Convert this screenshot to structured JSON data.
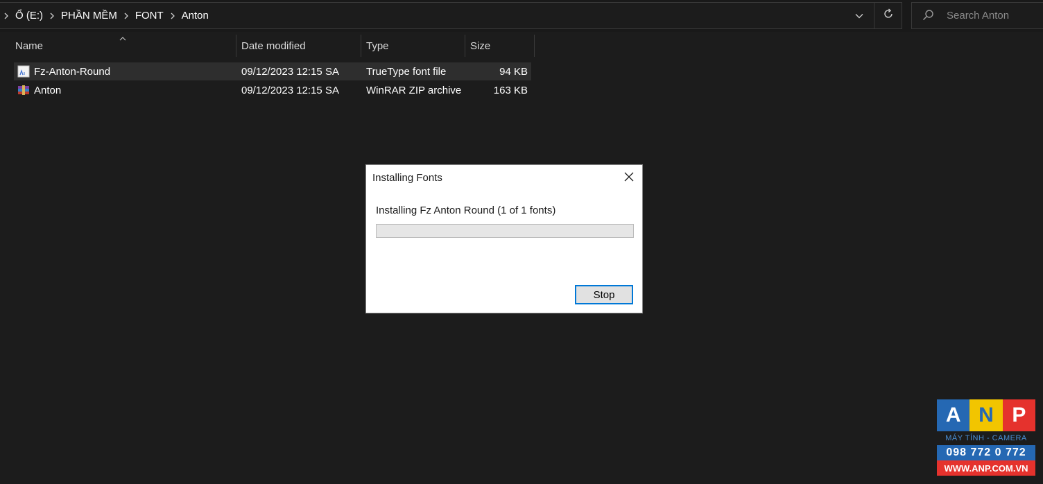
{
  "breadcrumb": {
    "items": [
      "Ổ (E:)",
      "PHẦN MỀM",
      "FONT",
      "Anton"
    ]
  },
  "search": {
    "placeholder": "Search Anton"
  },
  "columns": {
    "name": "Name",
    "date": "Date modified",
    "type": "Type",
    "size": "Size"
  },
  "files": [
    {
      "name": "Fz-Anton-Round",
      "date": "09/12/2023 12:15 SA",
      "type": "TrueType font file",
      "size": "94 KB",
      "icon": "font-file-icon",
      "selected": true
    },
    {
      "name": "Anton",
      "date": "09/12/2023 12:15 SA",
      "type": "WinRAR ZIP archive",
      "size": "163 KB",
      "icon": "winrar-archive-icon",
      "selected": false
    }
  ],
  "dialog": {
    "title": "Installing Fonts",
    "message": "Installing Fz Anton Round (1 of 1 fonts)",
    "progress": 0,
    "stop_label": "Stop"
  },
  "watermark": {
    "letters": [
      "A",
      "N",
      "P"
    ],
    "tagline": "MÁY TÍNH - CAMERA",
    "phone": "098 772 0 772",
    "website": "WWW.ANP.COM.VN"
  },
  "colors": {
    "background": "#1c1c1c",
    "selected_row": "#2e2e2e",
    "accent": "#0078d7",
    "logo_blue": "#2568b3",
    "logo_yellow": "#f2c500",
    "logo_red": "#e5322d"
  }
}
